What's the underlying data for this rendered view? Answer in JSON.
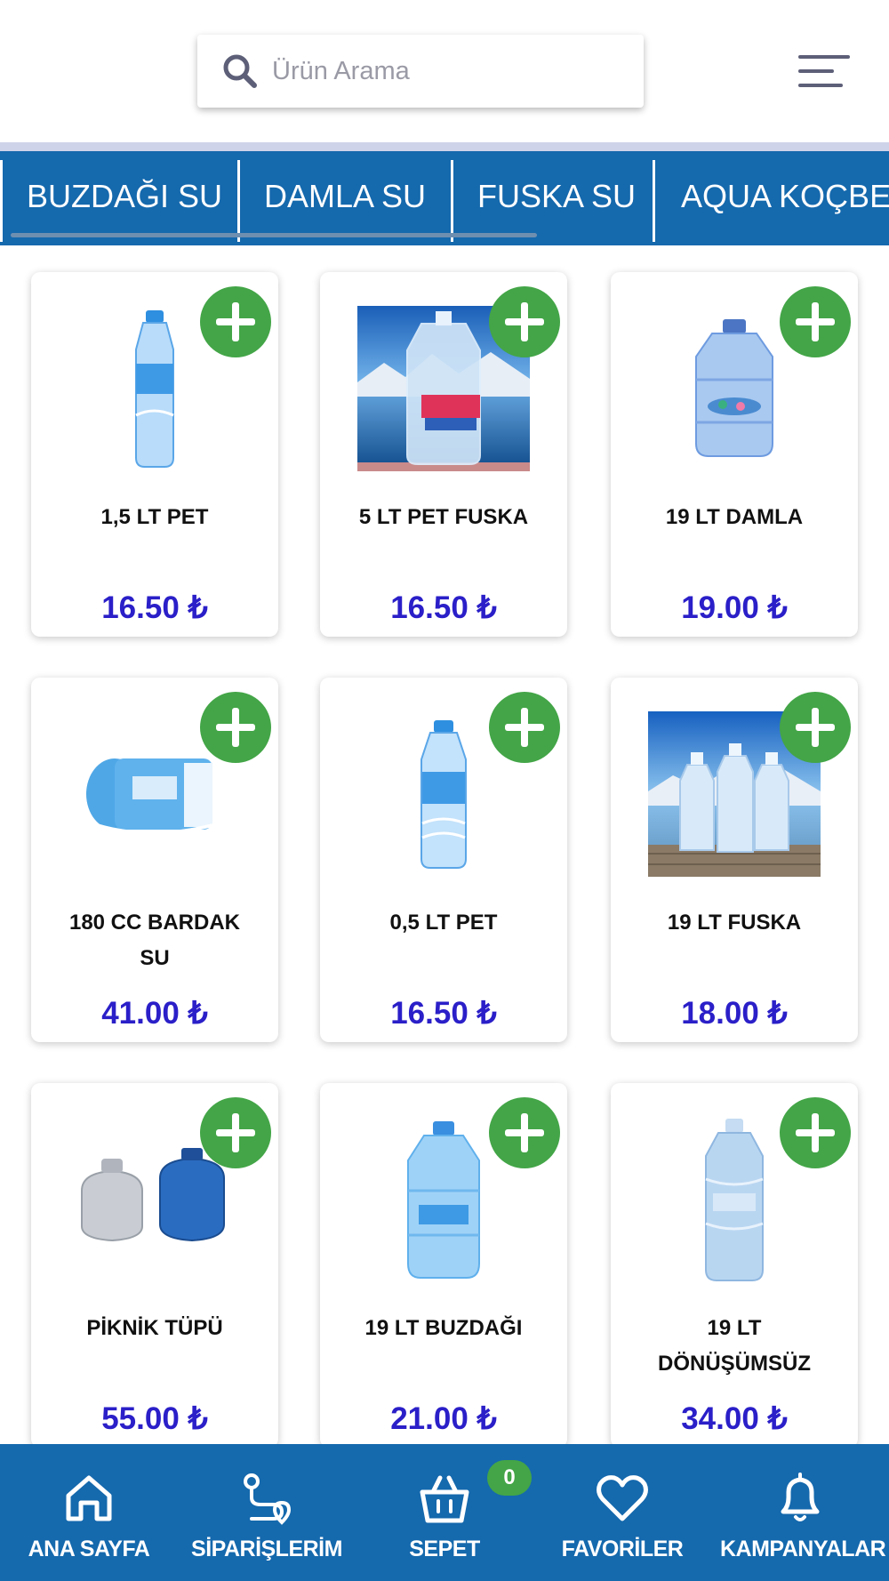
{
  "search": {
    "placeholder": "Ürün Arama",
    "icon": "search-icon"
  },
  "header": {
    "menu_icon": "menu-icon"
  },
  "categories": [
    "BUZDAĞI SU",
    "DAMLA SU",
    "FUSKA SU",
    "AQUA KOÇBEY"
  ],
  "products": [
    {
      "name": "1,5 LT PET",
      "price": "16.50 ₺",
      "image": "small-bottle"
    },
    {
      "name": "5 LT PET FUSKA",
      "price": "16.50 ₺",
      "image": "large-jug-lake"
    },
    {
      "name": "19 LT DAMLA",
      "price": "19.00 ₺",
      "image": "water-carboy"
    },
    {
      "name": "180 CC BARDAK\nSU",
      "price": "41.00 ₺",
      "image": "cup-water-pack"
    },
    {
      "name": "0,5 LT PET",
      "price": "16.50 ₺",
      "image": "small-bottle"
    },
    {
      "name": "19 LT FUSKA",
      "price": "18.00 ₺",
      "image": "three-bottles-lake"
    },
    {
      "name": "PİKNİK TÜPÜ",
      "price": "55.00 ₺",
      "image": "gas-canisters"
    },
    {
      "name": "19 LT BUZDAĞI",
      "price": "21.00 ₺",
      "image": "water-carboy"
    },
    {
      "name": "19 LT\nDÖNÜŞÜMSÜZ",
      "price": "34.00 ₺",
      "image": "tall-jug"
    }
  ],
  "bottom_nav": {
    "items": [
      {
        "label": "ANA SAYFA",
        "icon": "home-icon"
      },
      {
        "label": "SİPARİŞLERİM",
        "icon": "route-icon"
      },
      {
        "label": "SEPET",
        "icon": "basket-icon"
      },
      {
        "label": "FAVORİLER",
        "icon": "heart-icon"
      },
      {
        "label": "KAMPANYALAR",
        "icon": "bell-icon"
      }
    ],
    "cart_count": "0"
  },
  "colors": {
    "primary": "#1569ad",
    "accent_green": "#43a547",
    "price": "#2a1fc8"
  }
}
